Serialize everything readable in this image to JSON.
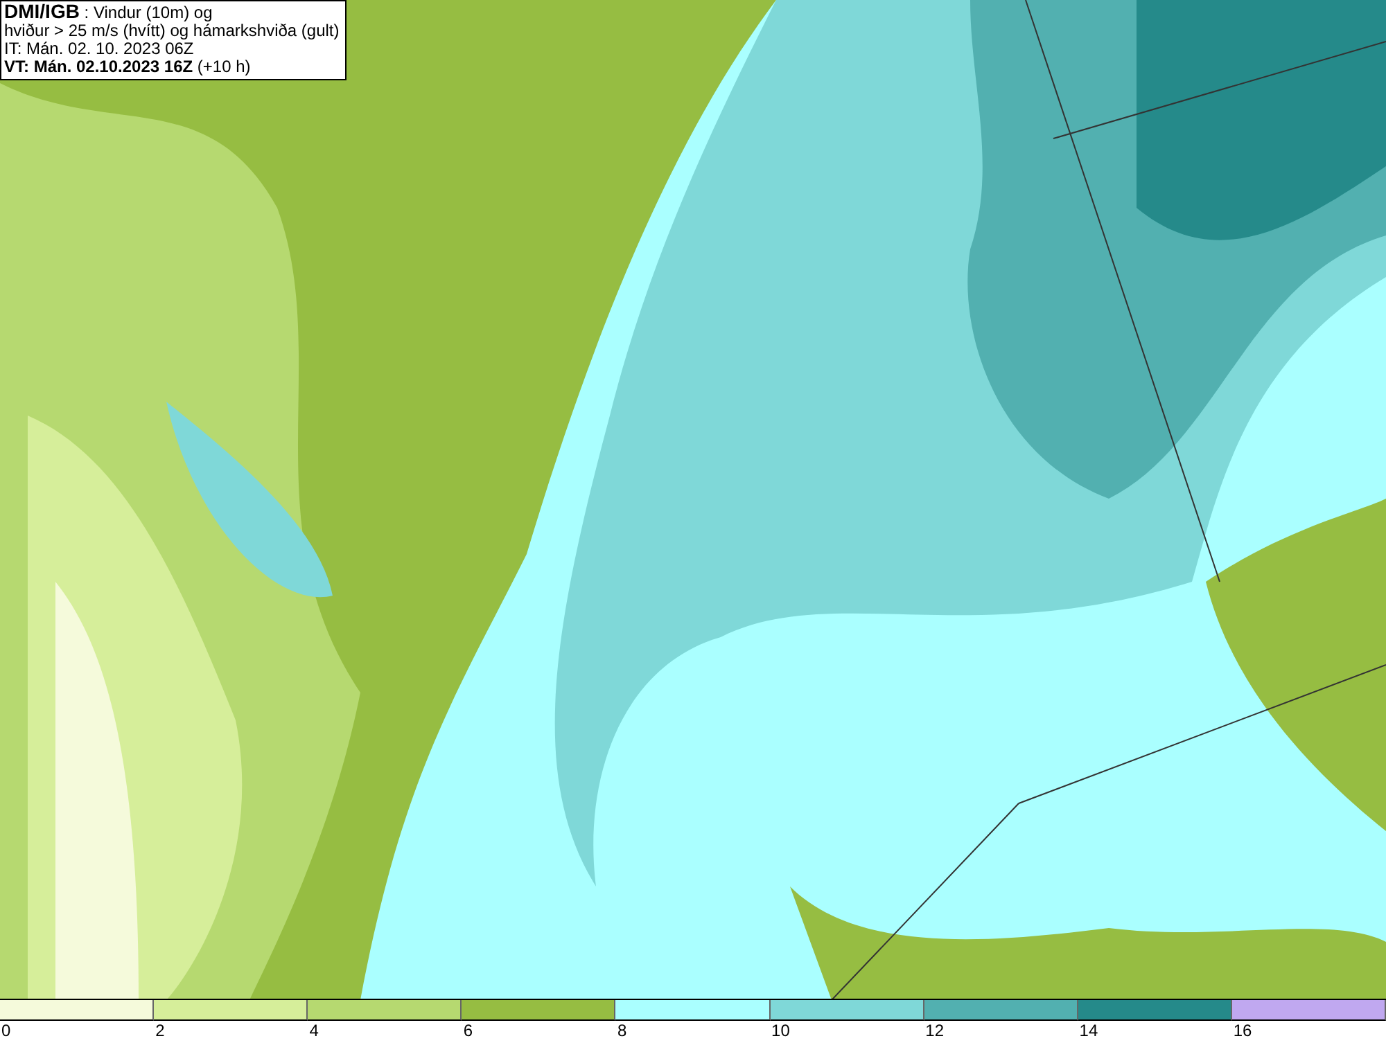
{
  "info_box": {
    "lines": [
      "**DMI/IGB** : Vindur (10m) og",
      "hviður > 25 m/s (hvítt) og hámarkshviða (gult)",
      "IT: Mán. 02. 10. 2023 06Z",
      "**VT: Mán. 02.10.2023 16Z** (+10 h)"
    ]
  },
  "legend": [
    {
      "label": "0",
      "color": "#f5fadb"
    },
    {
      "label": "2",
      "color": "#d6ee9a"
    },
    {
      "label": "4",
      "color": "#b6d970"
    },
    {
      "label": "6",
      "color": "#96bd42"
    },
    {
      "label": "8",
      "color": "#aaffff"
    },
    {
      "label": "10",
      "color": "#7fd8d8"
    },
    {
      "label": "12",
      "color": "#52b0b0"
    },
    {
      "label": "14",
      "color": "#258a8a"
    },
    {
      "label": "16",
      "color": "#c0a8f0"
    }
  ]
}
